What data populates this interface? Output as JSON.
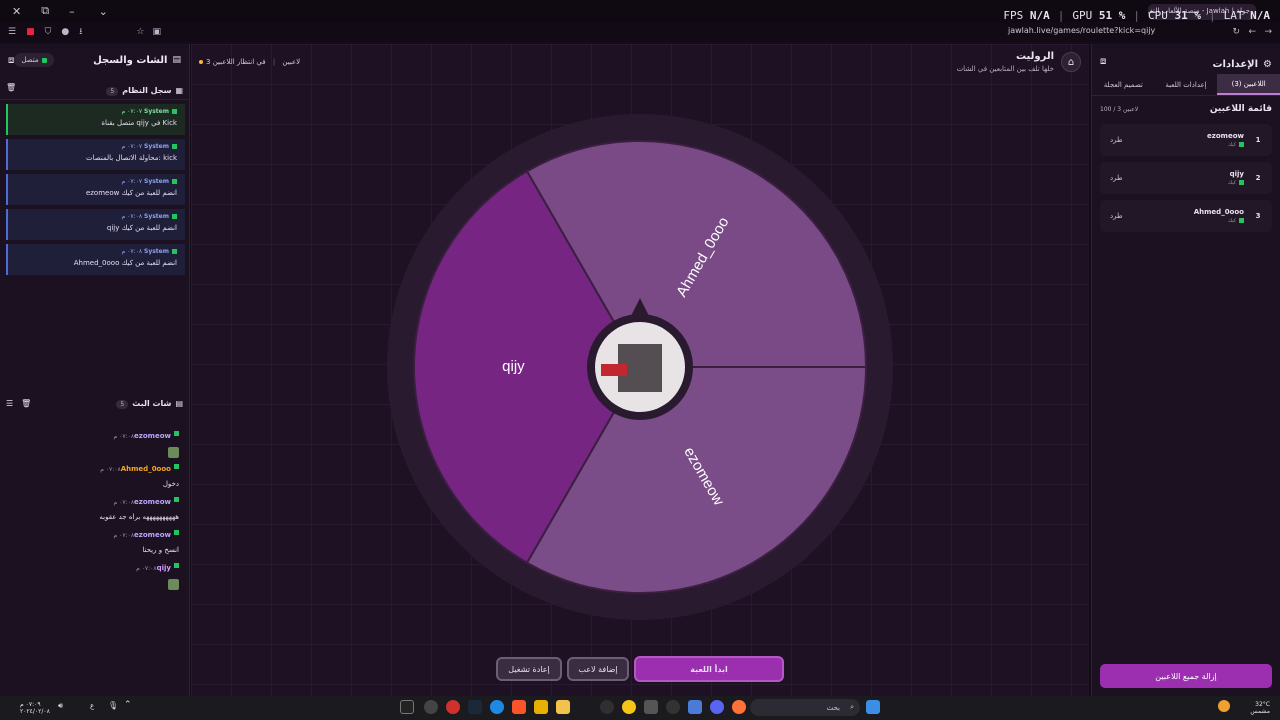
{
  "browser": {
    "tab_title": "جولة | Jawlah - منصة الألعاب التف",
    "url": "jawlah.live/games/roulette?kick=qijy",
    "hud": {
      "fps_label": "FPS",
      "fps_value": "N/A",
      "gpu_label": "GPU",
      "gpu_value": "51 %",
      "cpu_label": "CPU",
      "cpu_value": "31 %",
      "lat_label": "LAT",
      "lat_value": "N/A"
    }
  },
  "left_panel": {
    "title": "الشات والسجل",
    "status": "متصل",
    "system_log": {
      "title": "سجل النظام",
      "count": "5",
      "entries": [
        {
          "user": "System",
          "time": "٠٧:٠٧ م",
          "msg": "متصل بقناة qijy في Kick"
        },
        {
          "user": "System",
          "time": "٠٧:٠٧ م",
          "msg": "محاولة الاتصال بالمنصات: kick"
        },
        {
          "user": "System",
          "time": "٠٧:٠٧ م",
          "msg": "ezomeow انضم للعبة من كيك"
        },
        {
          "user": "System",
          "time": "٠٧:٠٨ م",
          "msg": "qijy انضم للعبة من كيك"
        },
        {
          "user": "System",
          "time": "٠٧:٠٨ م",
          "msg": "Ahmed_0ooo انضم للعبة من كيك"
        }
      ]
    },
    "chat": {
      "title": "شات البث",
      "count": "5",
      "messages": [
        {
          "user": "ezomeow",
          "time": "٠٧:٠٨ م",
          "text": "",
          "color": "#b9a7ff"
        },
        {
          "user": "Ahmed_0ooo",
          "time": "٠٧:٠٨ م",
          "text": "دخول",
          "color": "#f5a623"
        },
        {
          "user": "ezomeow",
          "time": "٠٧:٠٨ م",
          "text": "ههههههههههه براه جد عقوبه",
          "color": "#b9a7ff"
        },
        {
          "user": "ezomeow",
          "time": "٠٧:٠٨ م",
          "text": "انسخ و ريحنا",
          "color": "#b9a7ff"
        },
        {
          "user": "qijy",
          "time": "٠٧:٠٨ م",
          "text": "",
          "color": "#d59cff"
        }
      ]
    }
  },
  "center": {
    "title": "الروليت",
    "subtitle": "خلها تلف بين المتابعين في الشات",
    "players_count": "3 لاعبين",
    "waiting": "في انتظار اللاعبين",
    "wheel": {
      "segments": [
        {
          "name": "Ahmed_0ooo",
          "color": "#7a4a86"
        },
        {
          "name": "ezomeow",
          "color": "#7b4d88"
        },
        {
          "name": "qijy",
          "color": "#762682"
        }
      ]
    },
    "buttons": {
      "start": "ابدأ اللعبة",
      "add": "إضافة لاعب",
      "reset": "إعادة تشغيل"
    }
  },
  "right_panel": {
    "title": "الإعدادات",
    "tabs": [
      "اللاعبين (3)",
      "إعدادات اللعبة",
      "تصميم العجلة"
    ],
    "list_title": "قائمة اللاعبين",
    "list_count": "100 / 3 لاعبين",
    "kick_label": "طرد",
    "platform": "كيك",
    "players": [
      {
        "num": "1",
        "name": "ezomeow"
      },
      {
        "num": "2",
        "name": "qijy"
      },
      {
        "num": "3",
        "name": "Ahmed_0ooo"
      }
    ],
    "remove_all": "إزالة جميع اللاعبين"
  },
  "taskbar": {
    "search": "بحث",
    "clock_time": "٠٧:٠٩ م",
    "clock_date": "٢٠٢٤/٠٢/٠٨",
    "lang": "ع",
    "temp": "32°C",
    "weather": "مشمس"
  }
}
